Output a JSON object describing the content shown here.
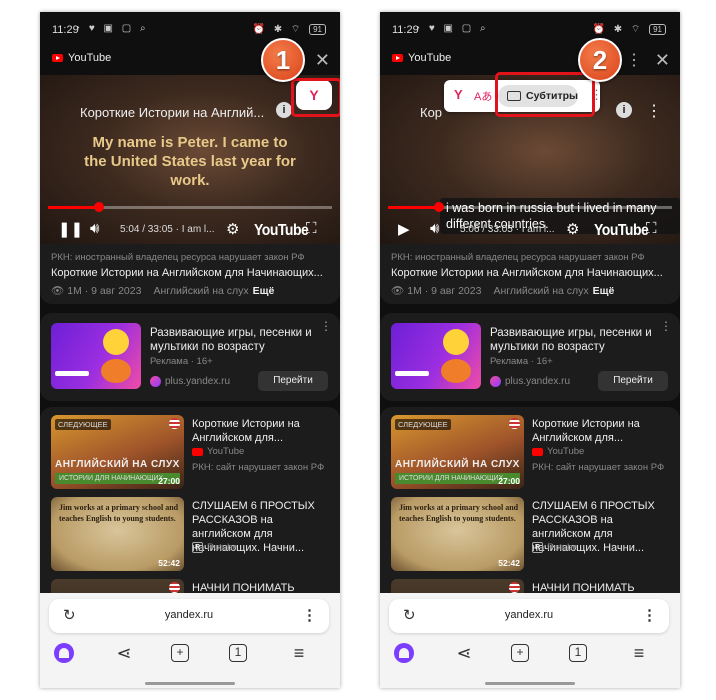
{
  "colors": {
    "accent_red": "#e3131b",
    "youtube_red": "#ff0000",
    "alice_purple": "#7b3dff",
    "step_badge": "#e0561f"
  },
  "phones": [
    {
      "status": {
        "time": "11:29",
        "battery": "91"
      },
      "header": {
        "source": "YouTube",
        "close_icon": "✕"
      },
      "video": {
        "title": "Короткие Истории на Англий...",
        "burned_subtitle": "My name is Peter. I came to the United States last year for work.",
        "timecode": "5:04 / 33:05 · I am l...",
        "brand": "YouTube",
        "progress_percent": 18,
        "playing": true
      },
      "step_number": "1",
      "yandex_button": "Y",
      "info": {
        "rkn": "РКН: иностранный владелец ресурса нарушает закон РФ",
        "title": "Короткие Истории на Английском для Начинающих...",
        "views": "1M · 9 авг 2023",
        "channel": "Английский на слух",
        "more": "Ещё"
      },
      "ad": {
        "title": "Развивающие игры, песенки и мультики по возрасту",
        "sub": "Реклама · 16+",
        "source": "plus.yandex.ru",
        "button": "Перейти"
      },
      "list": [
        {
          "title": "Короткие Истории на Английском для...",
          "source": "YouTube",
          "rkn": "РКН: сайт нарушает закон РФ",
          "badge": "СЛЕДУЮЩЕЕ",
          "overlay": "АНГЛИЙСКИЙ НА СЛУХ",
          "overlay2": "ИСТОРИИ ДЛЯ НАЧИНАЮЩИХ",
          "duration": "27:00"
        },
        {
          "title": "СЛУШАЕМ 6 ПРОСТЫХ РАССКАЗОВ на английском для начинающих. Начни...",
          "source": "Rutube",
          "thumb_text": "Jim works at a primary school and teaches English to young students.",
          "duration": "52:42"
        },
        {
          "title": "НАЧНИ ПОНИМАТЬ"
        }
      ],
      "browser": {
        "url": "yandex.ru"
      }
    },
    {
      "status": {
        "time": "11:29",
        "battery": "91"
      },
      "header": {
        "source": "YouTube",
        "close_icon": "✕"
      },
      "video": {
        "title": "Кор",
        "caption": "i was born in russia but i lived in many different countries.",
        "timecode": "5:06 / 33:05 · I am l...",
        "brand": "YouTube",
        "progress_percent": 18,
        "playing": false
      },
      "step_number": "2",
      "popup": {
        "subtitles_button": "Субтитры",
        "translate_icon": "Aあ"
      },
      "info": {
        "rkn": "РКН: иностранный владелец ресурса нарушает закон РФ",
        "title": "Короткие Истории на Английском для Начинающих...",
        "views": "1M · 9 авг 2023",
        "channel": "Английский на слух",
        "more": "Ещё"
      },
      "ad": {
        "title": "Развивающие игры, песенки и мультики по возрасту",
        "sub": "Реклама · 16+",
        "source": "plus.yandex.ru",
        "button": "Перейти"
      },
      "list": [
        {
          "title": "Короткие Истории на Английском для...",
          "source": "YouTube",
          "rkn": "РКН: сайт нарушает закон РФ",
          "badge": "СЛЕДУЮЩЕЕ",
          "overlay": "АНГЛИЙСКИЙ НА СЛУХ",
          "overlay2": "ИСТОРИИ ДЛЯ НАЧИНАЮЩИХ",
          "duration": "27:00"
        },
        {
          "title": "СЛУШАЕМ 6 ПРОСТЫХ РАССКАЗОВ на английском для начинающих. Начни...",
          "source": "Rutube",
          "thumb_text": "Jim works at a primary school and teaches English to young students.",
          "duration": "52:42"
        },
        {
          "title": "НАЧНИ ПОНИМАТЬ"
        }
      ],
      "browser": {
        "url": "yandex.ru"
      }
    }
  ]
}
